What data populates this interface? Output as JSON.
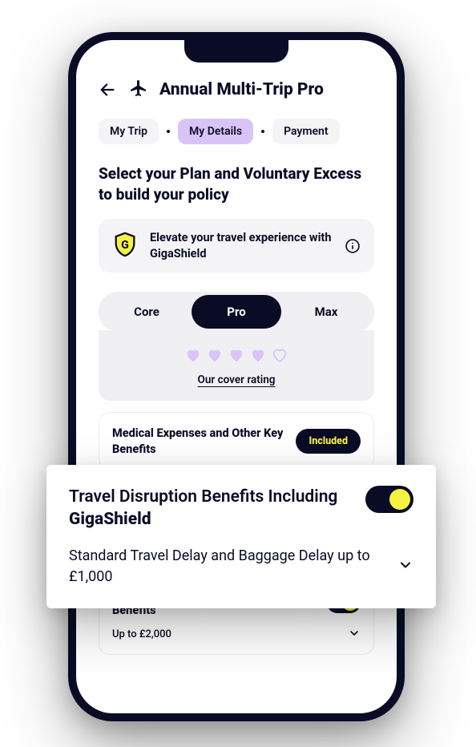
{
  "header": {
    "title": "Annual Multi-Trip Pro"
  },
  "stepper": {
    "step1": "My Trip",
    "step2": "My Details",
    "step3": "Payment"
  },
  "heading": "Select your Plan and Voluntary Excess to build your policy",
  "promo": {
    "text": "Elevate your travel experience with GigaShield"
  },
  "tiers": {
    "core": "Core",
    "pro": "Pro",
    "max": "Max"
  },
  "rating": {
    "label": "Our cover rating",
    "filled": 4,
    "total": 5
  },
  "benefits": {
    "medical": {
      "title": "Medical Expenses and Other Key Benefits",
      "badge": "Included"
    },
    "belongings": {
      "title": "Personal Belongings and Baggage Benefits",
      "sub": "Up to £2,000"
    }
  },
  "float": {
    "title_prefix": "Travel Disruption Benefits Including ",
    "title_strong": "GigaShield",
    "sub": "Standard Travel Delay and Baggage Delay up to £1,000"
  }
}
